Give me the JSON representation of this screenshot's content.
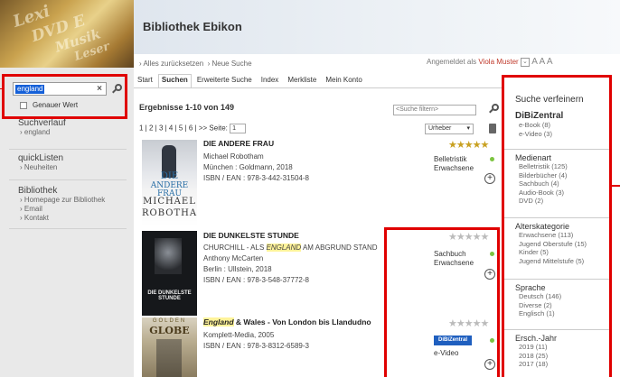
{
  "header": {
    "title": "Bibliothek Ebikon"
  },
  "logo": {
    "lines": [
      "Lexi",
      "DVD E",
      "Musik",
      "Leser"
    ]
  },
  "search": {
    "value": "england",
    "clear": "×",
    "exact_label": "Genauer Wert"
  },
  "leftnav": {
    "suchverlauf": {
      "title": "Suchverlauf",
      "items": [
        "england"
      ]
    },
    "quicklisten": {
      "title": "quickListen",
      "items": [
        "Neuheiten"
      ]
    },
    "bibliothek": {
      "title": "Bibliothek",
      "items": [
        "Homepage zur Bibliothek",
        "Email",
        "Kontakt"
      ]
    }
  },
  "breadcrumbs": {
    "reset": "Alles zurücksetzen",
    "new": "Neue Suche"
  },
  "login": {
    "prefix": "Angemeldet als",
    "user": "Viola Muster",
    "font_sizes": "A A A"
  },
  "tabs": [
    "Start",
    "Suchen",
    "Erweiterte Suche",
    "Index",
    "Merkliste",
    "Mein Konto"
  ],
  "active_tab": "Suchen",
  "results": {
    "heading": "Ergebnisse 1-10 von 149",
    "filter_placeholder": "<Suche filtern>",
    "pages": "1 | 2 | 3 | 4 | 5 | 6 | >> Seite:",
    "page_value": "1",
    "sort": "Urheber",
    "items": [
      {
        "title": "DIE ANDERE FRAU",
        "lines": [
          "Michael Robotham",
          "München : Goldmann, 2018",
          "ISBN / EAN : 978-3-442-31504-8"
        ],
        "media": [
          "Belletristik",
          "Erwachsene"
        ],
        "stars": "★★★★★",
        "cover_text": [
          "DIE",
          "ANDERE FRAU",
          "MICHAEL",
          "ROBOTHAM"
        ]
      },
      {
        "title": "DIE DUNKELSTE STUNDE",
        "line1_pre": "CHURCHILL - ALS ",
        "line1_hl": "ENGLAND",
        "line1_post": " AM ABGRUND STAND",
        "lines": [
          "Anthony McCarten",
          "Berlin : Ullstein, 2018",
          "ISBN / EAN : 978-3-548-37772-8"
        ],
        "media": [
          "Sachbuch",
          "Erwachsene"
        ],
        "stars": "★★★★★",
        "cover_text": [
          "DIE DUNKELSTE STUNDE"
        ]
      },
      {
        "title_hl": "England",
        "title_post": " & Wales - Von London bis Llandudno",
        "lines": [
          "Komplett-Media, 2005",
          "ISBN / EAN : 978-3-8312-6589-3"
        ],
        "badge": "DiBiZentral",
        "media": [
          "e-Video"
        ],
        "stars": "★★★★★",
        "cover_text": [
          "GOLDEN",
          "GLOBE"
        ]
      }
    ]
  },
  "refine": {
    "title": "Suche verfeinern",
    "dibizentral": {
      "title": "DiBiZentral",
      "items": [
        "e-Book (8)",
        "e-Video (3)"
      ]
    },
    "medienart": {
      "title": "Medienart",
      "items": [
        "Belletristik (125)",
        "Bilderbücher (4)",
        "Sachbuch (4)",
        "Audio-Book (3)",
        "DVD (2)"
      ]
    },
    "alter": {
      "title": "Alterskategorie",
      "items": [
        "Erwachsene (113)",
        "Jugend Oberstufe (15)",
        "Kinder (5)",
        "Jugend Mittelstufe (5)"
      ]
    },
    "sprache": {
      "title": "Sprache",
      "items": [
        "Deutsch (146)",
        "Diverse (2)",
        "Englisch (1)"
      ]
    },
    "jahr": {
      "title": "Ersch.-Jahr",
      "items": [
        "2019 (11)",
        "2018 (25)",
        "2017 (18)"
      ]
    }
  },
  "colors": {
    "highlight_red": "#e00000",
    "accent_green": "#7cc440",
    "star_gold": "#c8a020"
  }
}
